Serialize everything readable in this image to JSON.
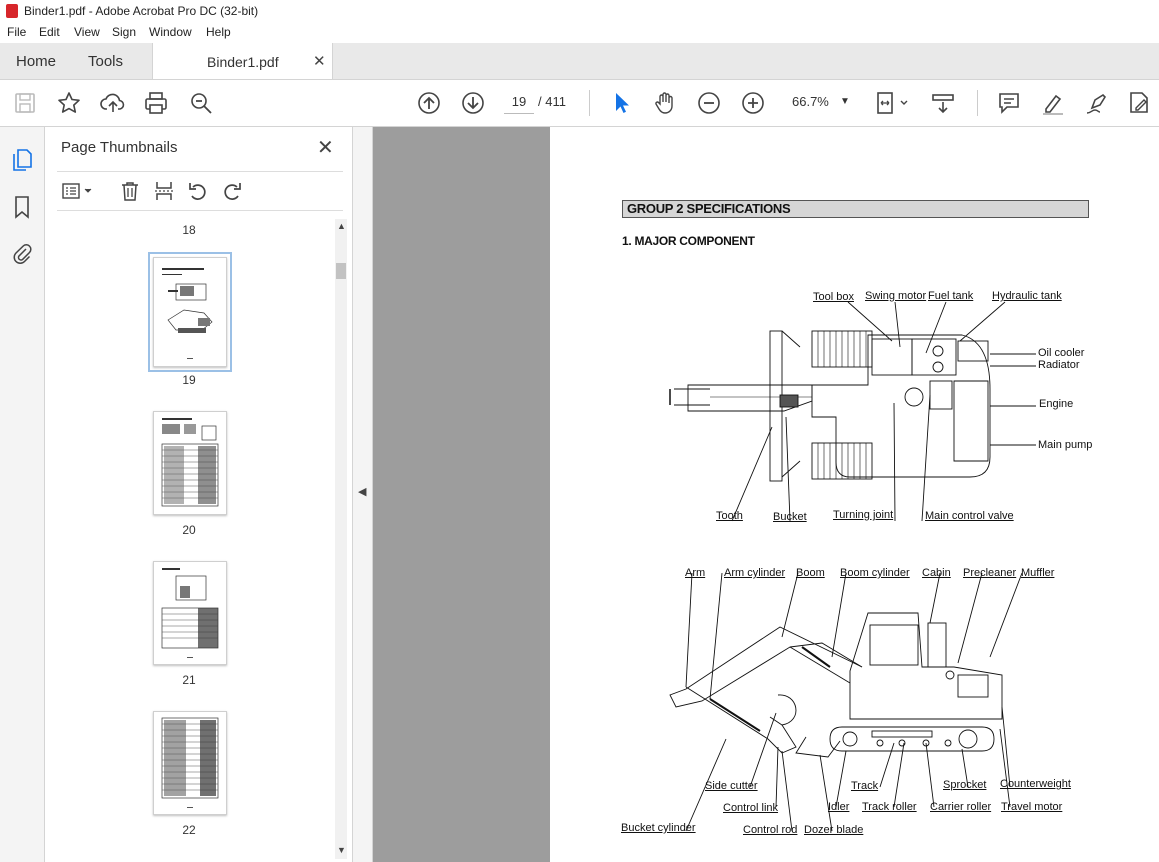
{
  "window": {
    "title": "Binder1.pdf - Adobe Acrobat Pro DC (32-bit)"
  },
  "menu": [
    "File",
    "Edit",
    "View",
    "Sign",
    "Window",
    "Help"
  ],
  "tabs": {
    "home": "Home",
    "tools": "Tools",
    "document": "Binder1.pdf"
  },
  "toolbar": {
    "current_page": "19",
    "page_total": "/ 411",
    "zoom": "66.7%"
  },
  "panel": {
    "title": "Page Thumbnails",
    "thumbnails": [
      {
        "label": "18"
      },
      {
        "label": "19",
        "selected": true
      },
      {
        "label": "20"
      },
      {
        "label": "21"
      },
      {
        "label": "22"
      }
    ]
  },
  "document": {
    "group_heading": "GROUP 2  SPECIFICATIONS",
    "section_heading": "1.  MAJOR COMPONENT",
    "top_view_labels": {
      "tool_box": "Tool box",
      "swing_motor": "Swing motor",
      "fuel_tank": "Fuel tank",
      "hydraulic_tank": "Hydraulic tank",
      "oil_cooler": "Oil cooler",
      "radiator": "Radiator",
      "engine": "Engine",
      "main_pump": "Main pump",
      "tooth": "Tooth",
      "bucket": "Bucket",
      "turning_joint": "Turning joint",
      "main_control_valve": "Main control valve"
    },
    "side_view_labels": {
      "arm": "Arm",
      "arm_cylinder": "Arm cylinder",
      "boom": "Boom",
      "boom_cylinder": "Boom cylinder",
      "cabin": "Cabin",
      "precleaner": "Precleaner",
      "muffler": "Muffler",
      "side_cutter": "Side cutter",
      "control_link": "Control link",
      "bucket_cylinder": "Bucket cylinder",
      "control_rod": "Control rod",
      "dozer_blade": "Dozer blade",
      "idler": "Idler",
      "track": "Track",
      "track_roller": "Track roller",
      "carrier_roller": "Carrier roller",
      "sprocket": "Sprocket",
      "counterweight": "Counterweight",
      "travel_motor": "Travel motor"
    }
  }
}
